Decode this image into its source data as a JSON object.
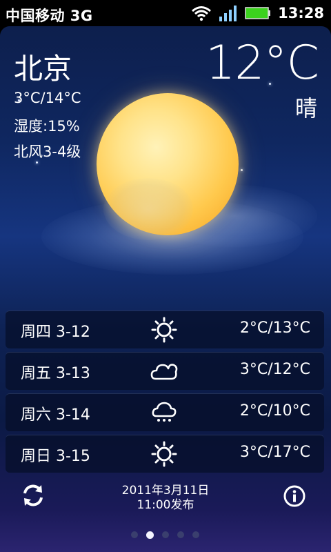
{
  "status_bar": {
    "carrier": "中国移动 3G",
    "time": "13:28"
  },
  "current": {
    "city": "北京",
    "range": "3°C/14°C",
    "humidity": "湿度:15%",
    "wind": "北风3-4级",
    "temperature": "12°C",
    "condition": "晴"
  },
  "forecast": [
    {
      "day": "周四 3-12",
      "icon": "sun-icon",
      "temp": "2°C/13°C"
    },
    {
      "day": "周五 3-13",
      "icon": "cloud-icon",
      "temp": "3°C/12°C"
    },
    {
      "day": "周六 3-14",
      "icon": "snow-cloud-icon",
      "temp": "2°C/10°C"
    },
    {
      "day": "周日 3-15",
      "icon": "sun-icon",
      "temp": "3°C/17°C"
    }
  ],
  "footer": {
    "publish_date": "2011年3月11日",
    "publish_time": "11:00发布",
    "page_count": 5,
    "active_page": 2
  },
  "colors": {
    "battery": "#3cd21e",
    "moon": "#ffc94d"
  }
}
